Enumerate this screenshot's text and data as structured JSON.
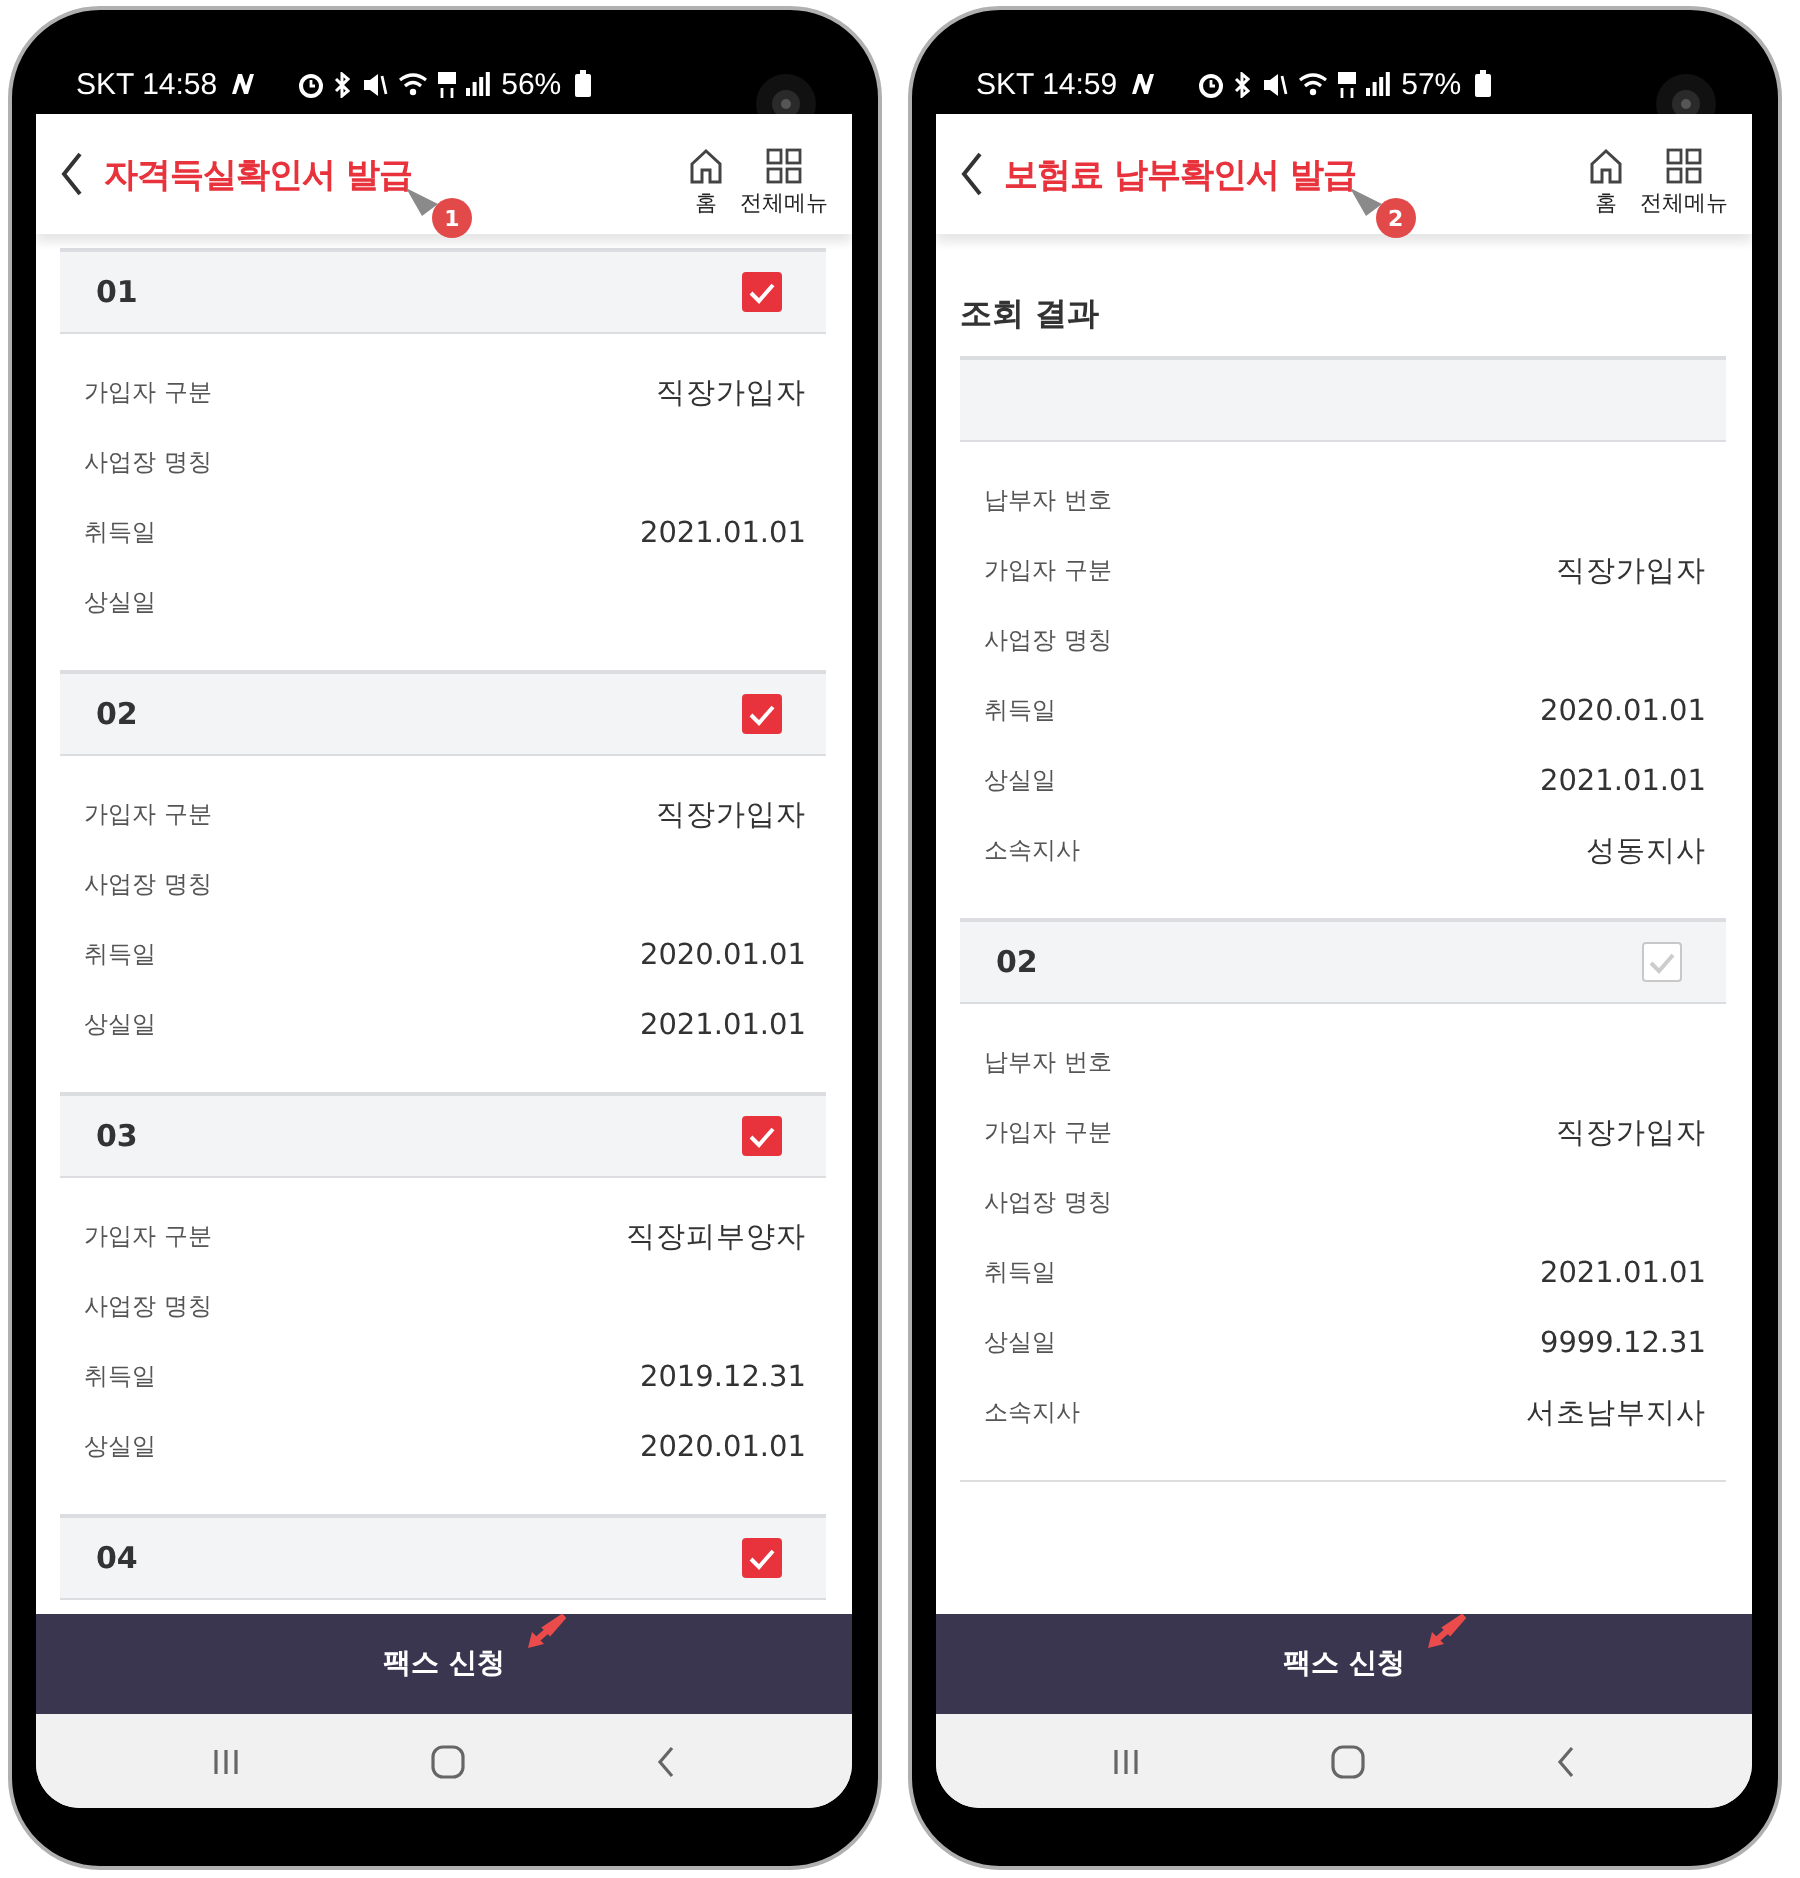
{
  "phones": [
    {
      "status_bar": {
        "carrier_time": "SKT 14:58",
        "battery": "56%"
      },
      "header": {
        "title": "자격득실확인서 발급",
        "home_label": "홈",
        "menu_label": "전체메뉴",
        "callout": "1"
      },
      "records": [
        {
          "kind": "numbered",
          "number": "01",
          "checked": true,
          "fields": [
            {
              "label": "가입자 구분",
              "value": "직장가입자"
            },
            {
              "label": "사업장 명칭"
            },
            {
              "label": "취득일",
              "value": "2021.01.01"
            },
            {
              "label": "상실일"
            }
          ]
        },
        {
          "kind": "numbered",
          "number": "02",
          "checked": true,
          "fields": [
            {
              "label": "가입자 구분",
              "value": "직장가입자"
            },
            {
              "label": "사업장 명칭"
            },
            {
              "label": "취득일",
              "value": "2020.01.01"
            },
            {
              "label": "상실일",
              "value": "2021.01.01"
            }
          ]
        },
        {
          "kind": "numbered",
          "number": "03",
          "checked": true,
          "fields": [
            {
              "label": "가입자 구분",
              "value": "직장피부양자"
            },
            {
              "label": "사업장 명칭"
            },
            {
              "label": "취득일",
              "value": "2019.12.31"
            },
            {
              "label": "상실일",
              "value": "2020.01.01"
            }
          ]
        },
        {
          "kind": "numbered",
          "number": "04",
          "checked": true
        }
      ],
      "action_button": "팩스 신청"
    },
    {
      "status_bar": {
        "carrier_time": "SKT 14:59",
        "battery": "57%"
      },
      "header": {
        "title": "보험료 납부확인서 발급",
        "home_label": "홈",
        "menu_label": "전체메뉴",
        "callout": "2"
      },
      "section_title": "조회 결과",
      "records": [
        {
          "kind": "untitled",
          "fields": [
            {
              "label": "납부자 번호"
            },
            {
              "label": "가입자 구분",
              "value": "직장가입자"
            },
            {
              "label": "사업장 명칭"
            },
            {
              "label": "취득일",
              "value": "2020.01.01"
            },
            {
              "label": "상실일",
              "value": "2021.01.01"
            },
            {
              "label": "소속지사",
              "value": "성동지사"
            }
          ]
        },
        {
          "kind": "numbered",
          "number": "02",
          "checked": false,
          "fields": [
            {
              "label": "납부자 번호"
            },
            {
              "label": "가입자 구분",
              "value": "직장가입자"
            },
            {
              "label": "사업장 명칭"
            },
            {
              "label": "취득일",
              "value": "2021.01.01"
            },
            {
              "label": "상실일",
              "value": "9999.12.31"
            },
            {
              "label": "소속지사",
              "value": "서초남부지사"
            }
          ]
        }
      ],
      "action_button": "팩스 신청"
    }
  ]
}
